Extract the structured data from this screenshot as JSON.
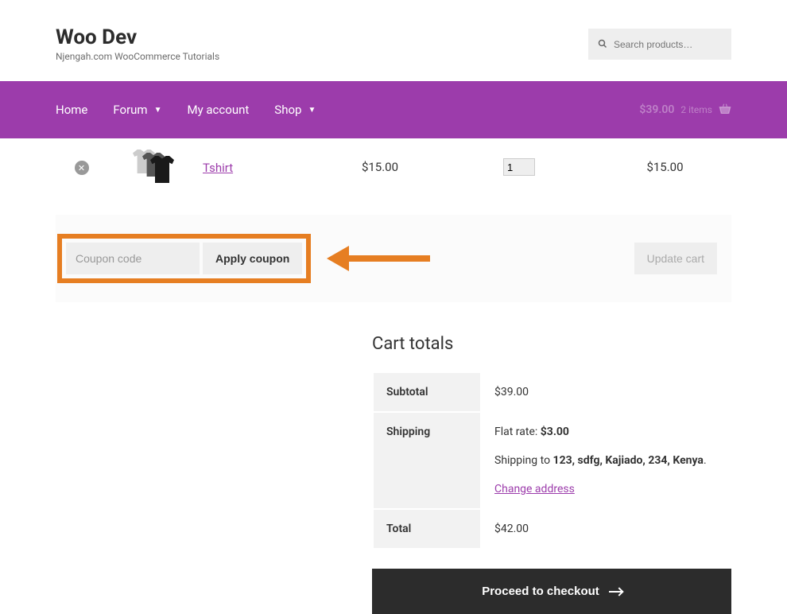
{
  "header": {
    "title": "Woo Dev",
    "subtitle": "Njengah.com WooCommerce Tutorials",
    "search_placeholder": "Search products…"
  },
  "nav": {
    "items": [
      {
        "label": "Home",
        "dropdown": false
      },
      {
        "label": "Forum",
        "dropdown": true
      },
      {
        "label": "My account",
        "dropdown": false
      },
      {
        "label": "Shop",
        "dropdown": true
      }
    ],
    "cart_amount": "$39.00",
    "cart_items": "2 items"
  },
  "cart": {
    "rows": [
      {
        "name": "Tshirt",
        "price": "$15.00",
        "qty": "1",
        "subtotal": "$15.00"
      }
    ],
    "coupon_placeholder": "Coupon code",
    "apply_label": "Apply coupon",
    "update_label": "Update cart"
  },
  "totals": {
    "heading": "Cart totals",
    "subtotal_label": "Subtotal",
    "subtotal": "$39.00",
    "shipping_label": "Shipping",
    "flat_rate_prefix": "Flat rate: ",
    "flat_rate_amount": "$3.00",
    "shipping_to_prefix": "Shipping to ",
    "shipping_addr": "123, sdfg, Kajiado, 234, Kenya",
    "change_addr": "Change address",
    "total_label": "Total",
    "total": "$42.00",
    "checkout_label": "Proceed to checkout"
  }
}
